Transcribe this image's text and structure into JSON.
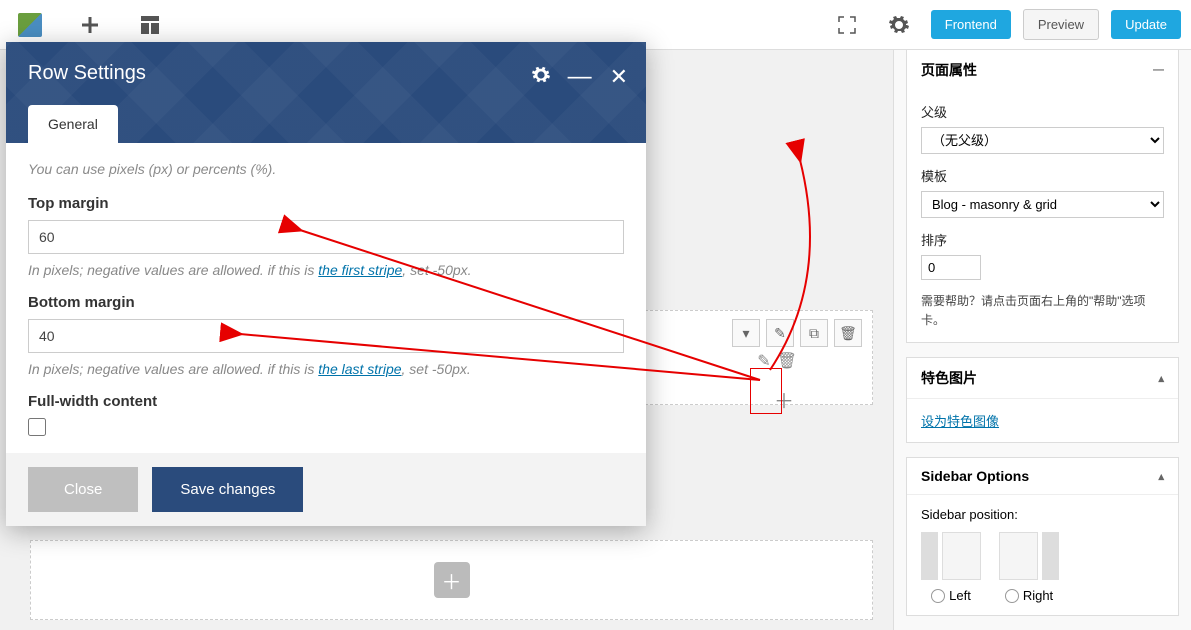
{
  "toolbar": {
    "frontend": "Frontend",
    "preview": "Preview",
    "update": "Update"
  },
  "modal": {
    "title": "Row Settings",
    "tab_general": "General",
    "hint_top": "You can use pixels (px) or percents (%).",
    "top_margin": {
      "label": "Top margin",
      "value": "60",
      "help_prefix": "In pixels; negative values are allowed. if this is ",
      "help_link": "the first stripe",
      "help_suffix": ", set -50px."
    },
    "bottom_margin": {
      "label": "Bottom margin",
      "value": "40",
      "help_prefix": "In pixels; negative values are allowed. if this is ",
      "help_link": "the last stripe",
      "help_suffix": ", set -50px."
    },
    "full_width_label": "Full-width content",
    "close_btn": "Close",
    "save_btn": "Save changes"
  },
  "sidebar": {
    "page_attrs": {
      "title": "页面属性",
      "parent_label": "父级",
      "parent_value": "（无父级）",
      "template_label": "模板",
      "template_value": "Blog - masonry & grid",
      "order_label": "排序",
      "order_value": "0",
      "help_text": "需要帮助？请点击页面右上角的\"帮助\"选项卡。"
    },
    "featured_image": {
      "title": "特色图片",
      "link": "设为特色图像"
    },
    "sidebar_options": {
      "title": "Sidebar Options",
      "position_label": "Sidebar position:",
      "left": "Left",
      "right": "Right"
    }
  }
}
